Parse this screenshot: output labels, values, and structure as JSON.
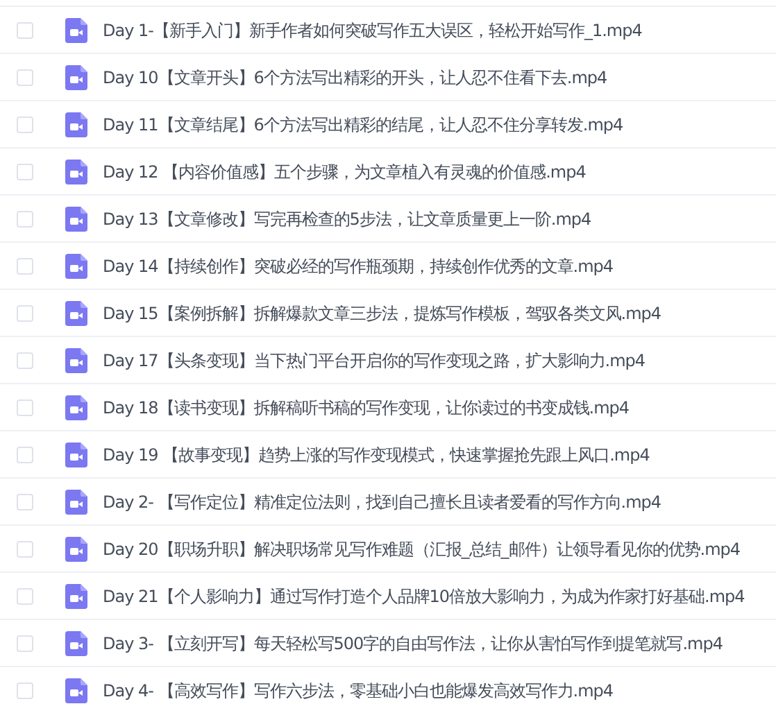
{
  "files": [
    {
      "name": "Day 1-【新手入门】新手作者如何突破写作五大误区，轻松开始写作_1.mp4",
      "checked": false
    },
    {
      "name": "Day 10【文章开头】6个方法写出精彩的开头，让人忍不住看下去.mp4",
      "checked": false
    },
    {
      "name": "Day 11【文章结尾】6个方法写出精彩的结尾，让人忍不住分享转发.mp4",
      "checked": false
    },
    {
      "name": "Day 12 【内容价值感】五个步骤，为文章植入有灵魂的价值感.mp4",
      "checked": false
    },
    {
      "name": "Day 13【文章修改】写完再检查的5步法，让文章质量更上一阶.mp4",
      "checked": false
    },
    {
      "name": "Day 14【持续创作】突破必经的写作瓶颈期，持续创作优秀的文章.mp4",
      "checked": false
    },
    {
      "name": "Day 15【案例拆解】拆解爆款文章三步法，提炼写作模板，驾驭各类文风.mp4",
      "checked": false
    },
    {
      "name": "Day 17【头条变现】当下热门平台开启你的写作变现之路，扩大影响力.mp4",
      "checked": false
    },
    {
      "name": "Day 18【读书变现】拆解稿听书稿的写作变现，让你读过的书变成钱.mp4",
      "checked": false
    },
    {
      "name": "Day 19 【故事变现】趋势上涨的写作变现模式，快速掌握抢先跟上风口.mp4",
      "checked": false
    },
    {
      "name": "Day 2- 【写作定位】精准定位法则，找到自己擅长且读者爱看的写作方向.mp4",
      "checked": false
    },
    {
      "name": "Day 20【职场升职】解决职场常见写作难题（汇报_总结_邮件）让领导看见你的优势.mp4",
      "checked": false
    },
    {
      "name": "Day 21【个人影响力】通过写作打造个人品牌10倍放大影响力，为成为作家打好基础.mp4",
      "checked": false
    },
    {
      "name": "Day 3- 【立刻开写】每天轻松写500字的自由写作法，让你从害怕写作到提笔就写.mp4",
      "checked": false
    },
    {
      "name": "Day 4- 【高效写作】写作六步法，零基础小白也能爆发高效写作力.mp4",
      "checked": false
    }
  ]
}
